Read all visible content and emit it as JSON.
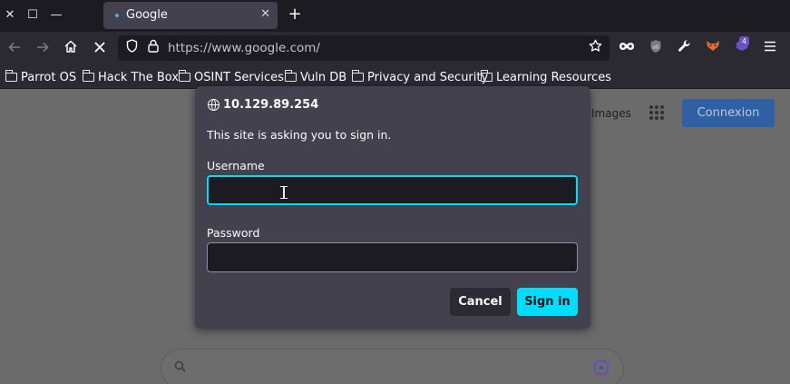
{
  "tabbar": {
    "close_glyph": "✕",
    "maximize_glyph": "☐",
    "minimize_glyph": "—",
    "tab_title": "Google",
    "tab_close_glyph": "✕",
    "new_tab_glyph": "+"
  },
  "navbar": {
    "url": "https://www.google.com/",
    "extensions": [
      "mask-icon",
      "ublock-icon",
      "wrench-icon",
      "foxyproxy-icon",
      "container-icon",
      "menu-icon"
    ],
    "extension_badge": "4"
  },
  "bookmarks": [
    {
      "label": "Parrot OS"
    },
    {
      "label": "Hack The Box"
    },
    {
      "label": "OSINT Services"
    },
    {
      "label": "Vuln DB"
    },
    {
      "label": "Privacy and Security"
    },
    {
      "label": "Learning Resources"
    }
  ],
  "page": {
    "images_link": "Images",
    "signin_button": "Connexion"
  },
  "dialog": {
    "host": "10.129.89.254",
    "message": "This site is asking you to sign in.",
    "username_label": "Username",
    "username_value": "",
    "password_label": "Password",
    "password_value": "",
    "cancel_label": "Cancel",
    "signin_label": "Sign in"
  },
  "colors": {
    "accent": "#00ddff",
    "dialog_bg": "#42414d",
    "toolbar_bg": "#2b2a33",
    "field_bg": "#1c1b22"
  }
}
